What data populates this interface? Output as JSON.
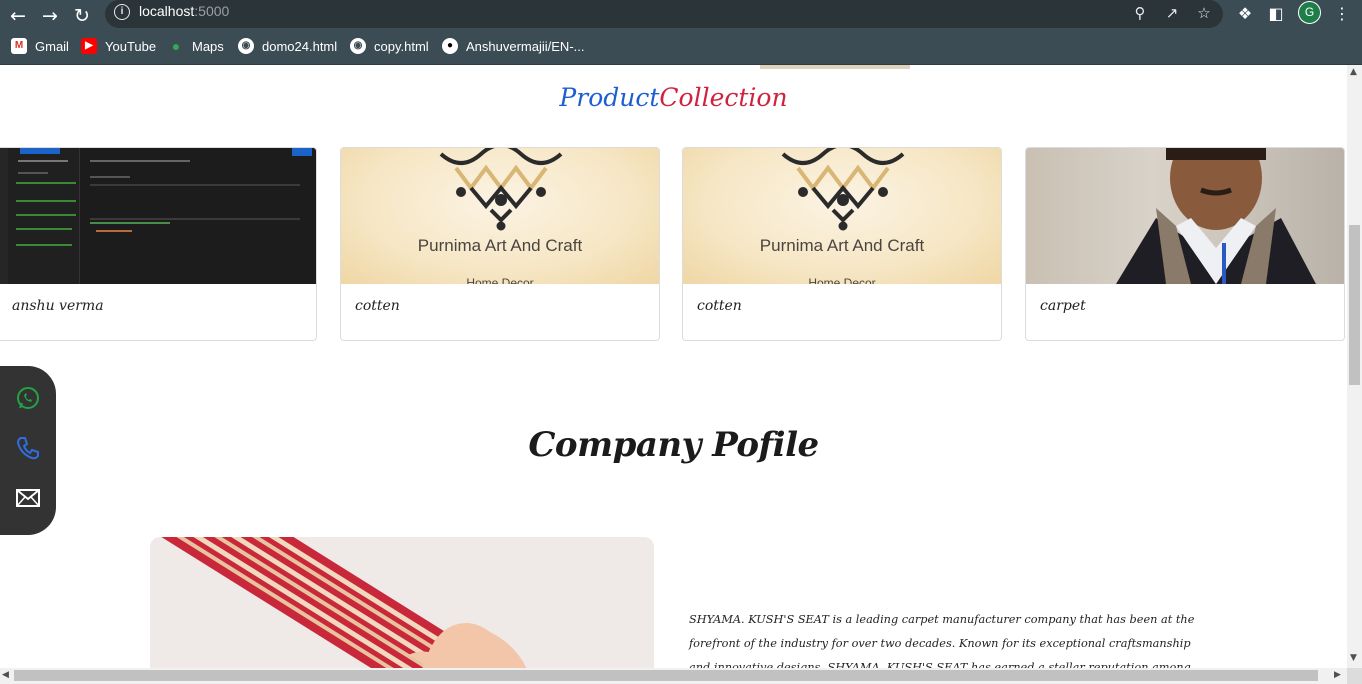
{
  "browser": {
    "url_host": "localhost",
    "url_port": ":5000",
    "avatar_letter": "G",
    "bookmarks": [
      {
        "label": "Gmail",
        "icon": "gmail-icon"
      },
      {
        "label": "YouTube",
        "icon": "youtube-icon"
      },
      {
        "label": "Maps",
        "icon": "maps-icon"
      },
      {
        "label": "domo24.html",
        "icon": "globe-icon"
      },
      {
        "label": "copy.html",
        "icon": "globe-icon"
      },
      {
        "label": "Anshuvermajii/EN-...",
        "icon": "github-icon"
      }
    ]
  },
  "collection": {
    "title_part1": "Product",
    "title_part2": "Collection",
    "colors": {
      "part1": "#1d5fd1",
      "part2": "#d0223f"
    },
    "cards": [
      {
        "label": "anshu verma",
        "image": "postman-screenshot"
      },
      {
        "label": "cotten",
        "image": "purnima-logo"
      },
      {
        "label": "cotten",
        "image": "purnima-logo"
      },
      {
        "label": "carpet",
        "image": "person-photo"
      }
    ],
    "craft_brand": "Purnima Art And Craft",
    "craft_sub": "Home Decor"
  },
  "contact": {
    "icons": [
      "whatsapp-icon",
      "phone-icon",
      "mail-icon"
    ]
  },
  "profile": {
    "heading": "Company Pofile",
    "description": "SHYAMA. KUSH'S SEAT is a leading carpet manufacturer company that has been at the forefront of the industry for over two decades. Known for its exceptional craftsmanship and innovative designs, SHYAMA. KUSH'S SEAT has earned a stellar reputation among homeowners, interior designers, and commercial"
  }
}
